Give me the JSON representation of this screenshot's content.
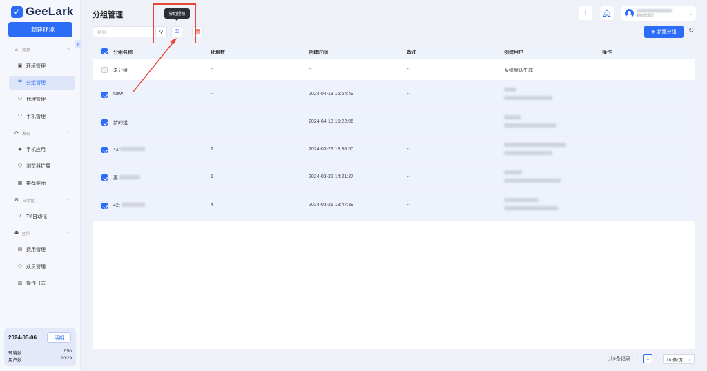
{
  "app": {
    "name": "GeeLark",
    "logo_icon": "geelark-logo-icon"
  },
  "sidebar": {
    "new_env_label": "+ 新建环境",
    "sections": [
      {
        "label": "常用",
        "items": [
          {
            "label": "环境管理",
            "icon": "window-icon"
          },
          {
            "label": "分组管理",
            "icon": "list-icon",
            "active": true
          },
          {
            "label": "代理管理",
            "icon": "proxy-icon"
          },
          {
            "label": "手机管理",
            "icon": "shield-icon"
          }
        ]
      },
      {
        "label": "发现",
        "items": [
          {
            "label": "手机应用",
            "icon": "app-icon"
          },
          {
            "label": "浏览器扩展",
            "icon": "puzzle-icon"
          },
          {
            "label": "推荐奖励",
            "icon": "gift-icon"
          }
        ]
      },
      {
        "label": "自动化",
        "items": [
          {
            "label": "TK自动化",
            "icon": "tiktok-icon"
          }
        ]
      },
      {
        "label": "团队",
        "items": [
          {
            "label": "费用管理",
            "icon": "bill-icon"
          },
          {
            "label": "成员管理",
            "icon": "members-icon"
          },
          {
            "label": "操作日志",
            "icon": "log-icon"
          }
        ]
      }
    ],
    "plan": {
      "date": "2024-05-06",
      "renew_label": "续期",
      "env_label": "环境数",
      "env_value": "7/50",
      "user_label": "用户数",
      "user_value": "20/29"
    }
  },
  "header": {
    "title": "分组管理",
    "user_role": "超级管理员"
  },
  "toolbar": {
    "search_placeholder": "搜索",
    "tooltip": "分组授权",
    "new_group_label": "新建分组"
  },
  "table": {
    "columns": [
      "分组名称",
      "环境数",
      "创建时间",
      "备注",
      "创建用户",
      "操作"
    ],
    "rows": [
      {
        "name": "未分组",
        "count": "--",
        "time": "--",
        "note": "--",
        "creator": "系统默认生成",
        "selected": false,
        "blurred_name": false,
        "blurred_creator": false
      },
      {
        "name": "New",
        "count": "--",
        "time": "2024-04-18 16:54:49",
        "note": "--",
        "creator": "",
        "selected": true,
        "blurred_name": false,
        "blurred_creator": true
      },
      {
        "name": "新的组",
        "count": "--",
        "time": "2024-04-18 15:22:06",
        "note": "--",
        "creator": "",
        "selected": true,
        "blurred_name": false,
        "blurred_creator": true
      },
      {
        "name": "42",
        "count": "2",
        "time": "2024-03-29 13:38:50",
        "note": "--",
        "creator": "",
        "selected": true,
        "blurred_name": true,
        "blurred_creator": true
      },
      {
        "name": "妻",
        "count": "1",
        "time": "2024-03-22 14:21:27",
        "note": "--",
        "creator": "",
        "selected": true,
        "blurred_name": true,
        "blurred_creator": true
      },
      {
        "name": "42t",
        "count": "4",
        "time": "2024-03-21 18:47:39",
        "note": "--",
        "creator": "",
        "selected": true,
        "blurred_name": true,
        "blurred_creator": true
      }
    ]
  },
  "pagination": {
    "total_label": "共5条记录",
    "current_page": "1",
    "page_size": "10 条/页"
  },
  "colors": {
    "accent": "#2d6cf6",
    "highlight": "#e8463a"
  }
}
